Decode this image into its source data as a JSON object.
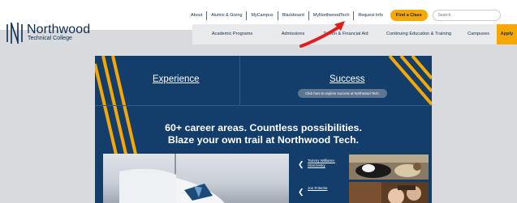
{
  "topbar": {
    "links": [
      "About",
      "Alumni & Giving",
      "MyCampus",
      "Blackboard",
      "MyNorthwoodTech",
      "Request Info"
    ],
    "find_class_label": "Find a Class",
    "search_placeholder": "Search"
  },
  "logo": {
    "name": "Northwood",
    "subtitle": "Technical College"
  },
  "mainnav": {
    "items": [
      "Academic Programs",
      "Admissions",
      "Tuition & Financial Aid",
      "Continuing Education & Training",
      "Campuses"
    ],
    "apply_label": "Apply"
  },
  "hero": {
    "experience_label": "Experience",
    "success_label": "Success",
    "success_cta": "Click here to explore success at Northwood Tech.",
    "headline_line1": "60+ career areas. Countless possibilities.",
    "headline_line2": "Blaze your own trail at Northwood Tech.",
    "stories": [
      {
        "name": "Tammy Williams-Stanzinsky"
      },
      {
        "name": "Jon Fritsche"
      }
    ]
  },
  "colors": {
    "brand_navy": "#0f2d52",
    "hero_blue": "#133e6b",
    "accent_orange": "#f6a800",
    "annotation_red": "#e11d1d"
  }
}
